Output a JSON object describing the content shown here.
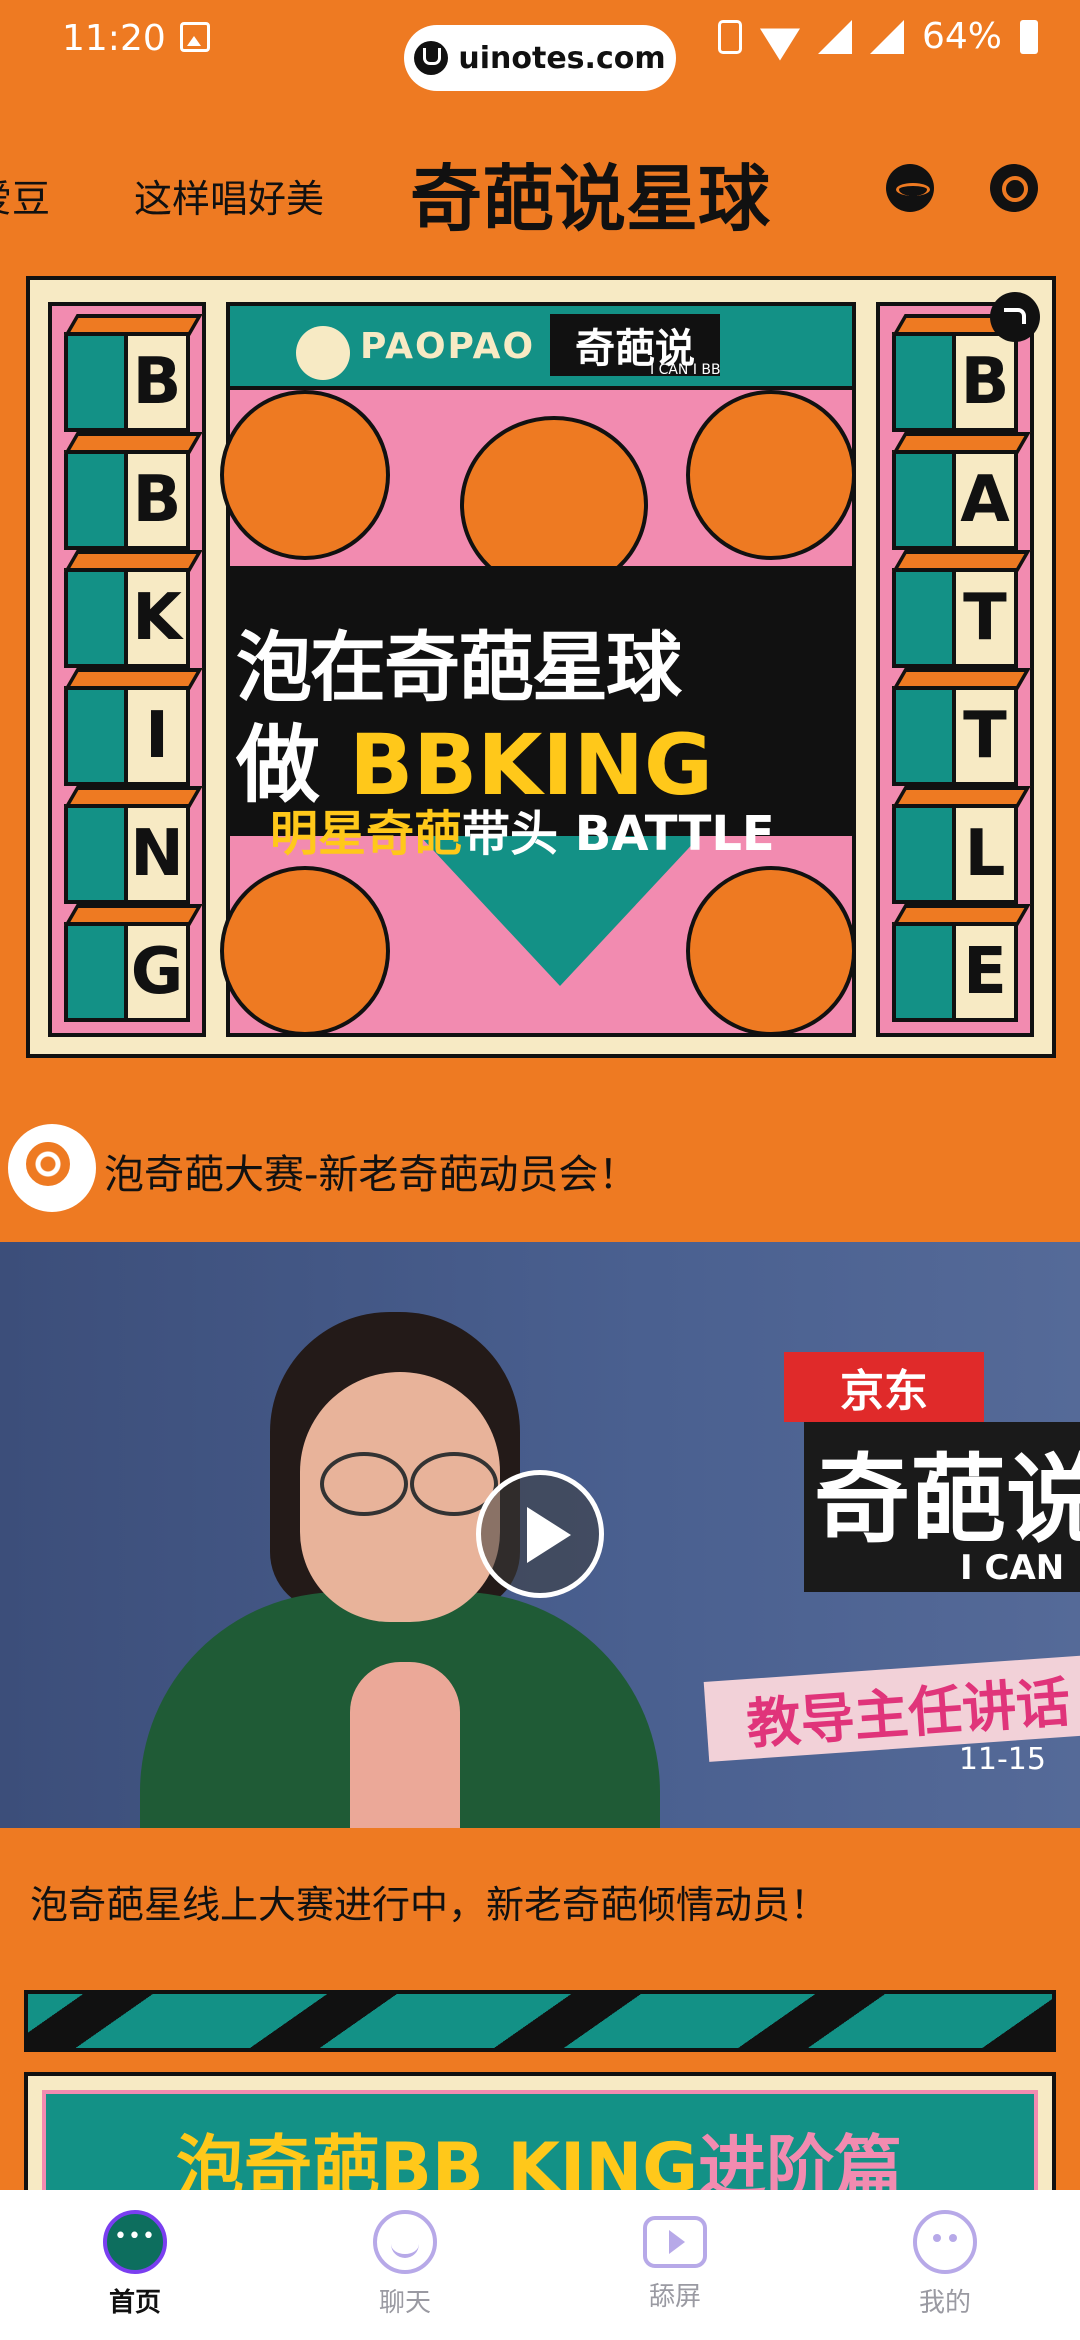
{
  "status_bar": {
    "time": "11:20",
    "url": "uinotes.com",
    "battery": "64%"
  },
  "top_nav": {
    "tabs": [
      "爱豆",
      "这样唱好美",
      "奇葩说星球"
    ],
    "active_index": 2,
    "icons": [
      "planet-icon",
      "search-icon"
    ]
  },
  "banner": {
    "brand": "PAOPAO",
    "show_logo": "奇葩说",
    "show_logo_sub": "I CAN I BB",
    "left_column_letters": [
      "B",
      "B",
      "K",
      "I",
      "N",
      "G"
    ],
    "right_column_letters": [
      "B",
      "A",
      "T",
      "T",
      "L",
      "E"
    ],
    "headline_line1": "泡在奇葩星球",
    "headline_line2_prefix": "做",
    "headline_line2_highlight": "BBKING",
    "headline_line3_highlight": "明星奇葩",
    "headline_line3_rest": "带头 BATTLE"
  },
  "post": {
    "title": "泡奇葩大赛-新老奇葩动员会！",
    "video": {
      "sign_brand": "京东",
      "sign_show": "奇葩说",
      "sign_sub": "I CAN",
      "tag": "教导主任讲话",
      "date": "11-15"
    },
    "description": "泡奇葩星线上大赛进行中，新老奇葩倾情动员！"
  },
  "banner2": {
    "title_main": "泡奇葩BB KING",
    "title_accent": "进阶篇"
  },
  "bottom_bar": {
    "items": [
      {
        "label": "首页",
        "icon": "home-icon"
      },
      {
        "label": "聊天",
        "icon": "chat-icon"
      },
      {
        "label": "舔屏",
        "icon": "screen-icon"
      },
      {
        "label": "我的",
        "icon": "profile-icon"
      }
    ],
    "active_index": 0
  },
  "colors": {
    "background": "#EE7A22",
    "teal": "#139186",
    "pink": "#F28BB0",
    "yellow": "#FFC81A",
    "inactive_icon": "#B7A9E8"
  }
}
